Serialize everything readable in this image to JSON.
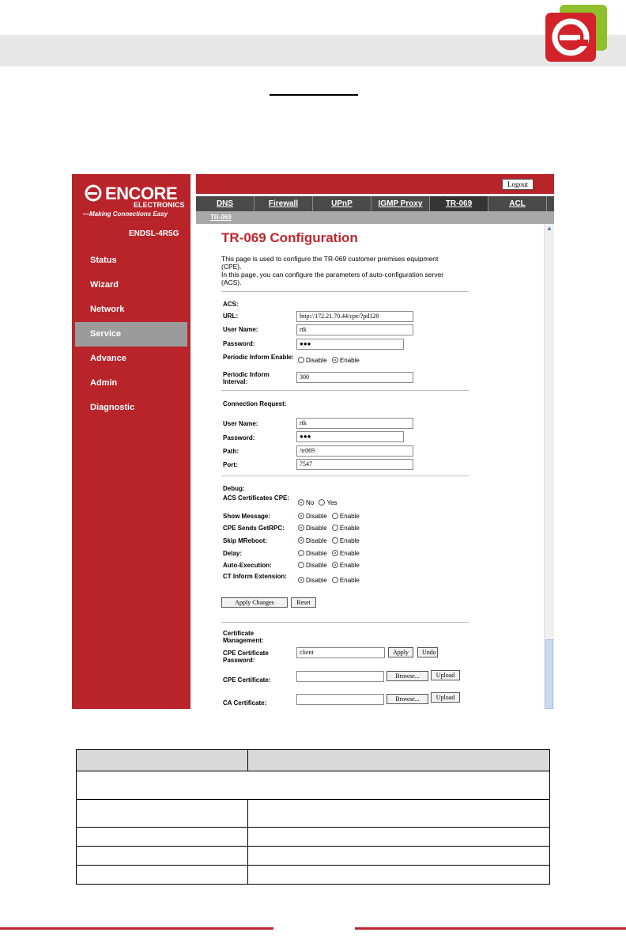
{
  "colors": {
    "brand_red": "#b8242a",
    "title_red": "#c0262d",
    "tab_dark": "#4a4a4a"
  },
  "brand": {
    "name": "ENCORE",
    "sub": "ELECTRONICS",
    "tagline": "—Making Connections Easy",
    "model": "ENDSL-4R5G"
  },
  "sidebar": {
    "items": [
      {
        "label": "Status"
      },
      {
        "label": "Wizard"
      },
      {
        "label": "Network"
      },
      {
        "label": "Service",
        "active": true
      },
      {
        "label": "Advance"
      },
      {
        "label": "Admin"
      },
      {
        "label": "Diagnostic"
      }
    ]
  },
  "topbar": {
    "logout_label": "Logout"
  },
  "tabs": [
    {
      "label": "DNS"
    },
    {
      "label": "Firewall"
    },
    {
      "label": "UPnP"
    },
    {
      "label": "IGMP Proxy"
    },
    {
      "label": "TR-069",
      "active": true
    },
    {
      "label": "ACL"
    }
  ],
  "subtab": "TR-069",
  "page": {
    "title": "TR-069 Configuration",
    "desc1": "This page is used to configure the TR-069 customer premises equipment (CPE).",
    "desc2": "In this page, you can configure the parameters of auto-configuration server (ACS)."
  },
  "acs": {
    "heading": "ACS:",
    "url_label": "URL:",
    "url_value": "http://172.21.70.44/cpe/?pd128",
    "user_label": "User Name:",
    "user_value": "rtk",
    "pass_label": "Password:",
    "pass_value": "●●●",
    "periodic_enable_label": "Periodic Inform Enable:",
    "disable": "Disable",
    "enable": "Enable",
    "periodic_interval_label": "Periodic Inform Interval:",
    "periodic_interval_value": "300"
  },
  "conn": {
    "heading": "Connection Request:",
    "user_label": "User Name:",
    "user_value": "rtk",
    "pass_label": "Password:",
    "pass_value": "●●●",
    "path_label": "Path:",
    "path_value": "/tr069",
    "port_label": "Port:",
    "port_value": "7547"
  },
  "debug": {
    "heading": "Debug:",
    "acs_cert_label": "ACS Certificates CPE:",
    "no": "No",
    "yes": "Yes",
    "show_msg_label": "Show Message:",
    "getrpc_label": "CPE Sends GetRPC:",
    "skip_label": "Skip MReboot:",
    "delay_label": "Delay:",
    "auto_label": "Auto-Execution:",
    "ct_label": "CT Inform Extension:",
    "disable": "Disable",
    "enable": "Enable"
  },
  "actions": {
    "apply": "Apply Changes",
    "reset": "Reset"
  },
  "cert": {
    "heading": "Certificate Management:",
    "cpe_pass_label": "CPE Certificate Password:",
    "cpe_pass_value": "client",
    "apply": "Apply",
    "undo": "Undo",
    "cpe_cert_label": "CPE Certificate:",
    "ca_cert_label": "CA Certificate:",
    "browse": "Browse...",
    "upload": "Upload"
  }
}
